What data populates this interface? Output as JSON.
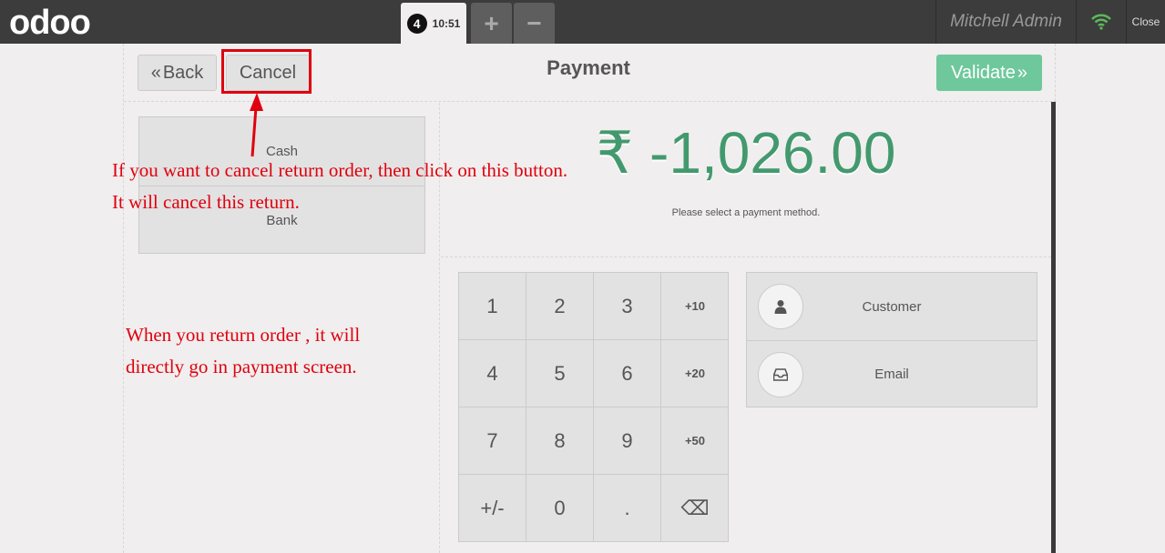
{
  "topbar": {
    "logo": "odoo",
    "order_number": "4",
    "order_time": "10:51",
    "add_label": "+",
    "remove_label": "−",
    "user": "Mitchell Admin",
    "close_label": "Close"
  },
  "header": {
    "back_label": "Back",
    "cancel_label": "Cancel",
    "title": "Payment",
    "validate_label": "Validate"
  },
  "payment_methods": [
    "Cash",
    "Bank"
  ],
  "amount": {
    "value": "₹ -1,026.00",
    "hint": "Please select a payment method."
  },
  "numpad": [
    "1",
    "2",
    "3",
    "+10",
    "4",
    "5",
    "6",
    "+20",
    "7",
    "8",
    "9",
    "+50",
    "+/-",
    "0",
    ".",
    "⌫"
  ],
  "extras": {
    "customer_label": "Customer",
    "email_label": "Email"
  },
  "annotations": {
    "cancel_line1": "If you want to cancel return order, then click on this button.",
    "cancel_line2": "It will cancel this return.",
    "return_line1": "When you return order , it will",
    "return_line2": "directly go in payment screen."
  },
  "colors": {
    "accent": "#43996e",
    "validate": "#6ec89b",
    "annotation": "#e0000e",
    "topbar": "#3c3c3c"
  }
}
